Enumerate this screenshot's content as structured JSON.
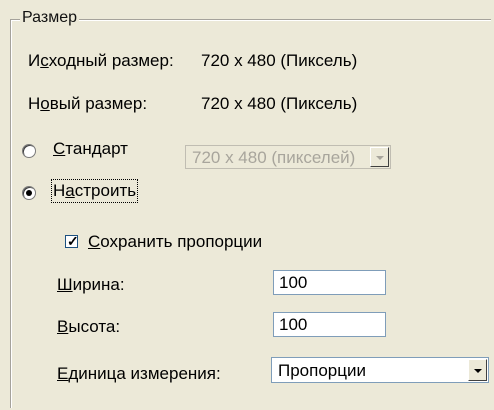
{
  "group": {
    "legend": "Размер"
  },
  "original": {
    "label_pre": "И",
    "label_u": "с",
    "label_post": "ходный размер:",
    "value": "720 x 480 (Пиксель)"
  },
  "new_size": {
    "label_pre": "Н",
    "label_u": "о",
    "label_post": "вый размер:",
    "value": "720 x 480 (Пиксель)"
  },
  "standard": {
    "label_u": "С",
    "label_post": "тандарт",
    "checked": false,
    "combo_value": "720 x 480 (пикселей)"
  },
  "custom": {
    "label_pre": "Н",
    "label_u": "а",
    "label_post": "строить",
    "checked": true
  },
  "keep_ratio": {
    "label_u": "С",
    "label_post": "охранить пропорции",
    "checked": true
  },
  "width": {
    "label_u": "Ш",
    "label_post": "ирина:",
    "value": "100"
  },
  "height": {
    "label_u": "В",
    "label_post": "ысота:",
    "value": "100"
  },
  "units": {
    "label_u": "Е",
    "label_post": "диница измерения:",
    "value": "Пропорции"
  },
  "icons": {
    "dropdown": "chevron-down-icon",
    "check": "check-icon"
  }
}
